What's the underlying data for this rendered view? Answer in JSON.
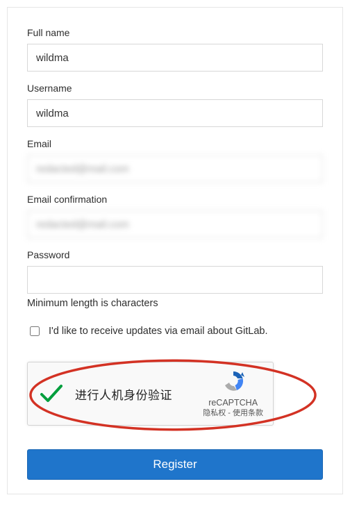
{
  "form": {
    "fullName": {
      "label": "Full name",
      "value": "wildma"
    },
    "username": {
      "label": "Username",
      "value": "wildma"
    },
    "email": {
      "label": "Email",
      "value": "redacted@mail.com",
      "blurred": true
    },
    "emailConfirm": {
      "label": "Email confirmation",
      "value": "redacted@mail.com",
      "blurred": true
    },
    "password": {
      "label": "Password",
      "value": "",
      "helper": "Minimum length is characters"
    },
    "newsletter": {
      "label": "I'd like to receive updates via email about GitLab.",
      "checked": false
    },
    "captcha": {
      "verified": true,
      "text": "进行人机身份验证",
      "brand": "reCAPTCHA",
      "links": "隐私权 - 使用条款"
    },
    "submit": "Register"
  }
}
